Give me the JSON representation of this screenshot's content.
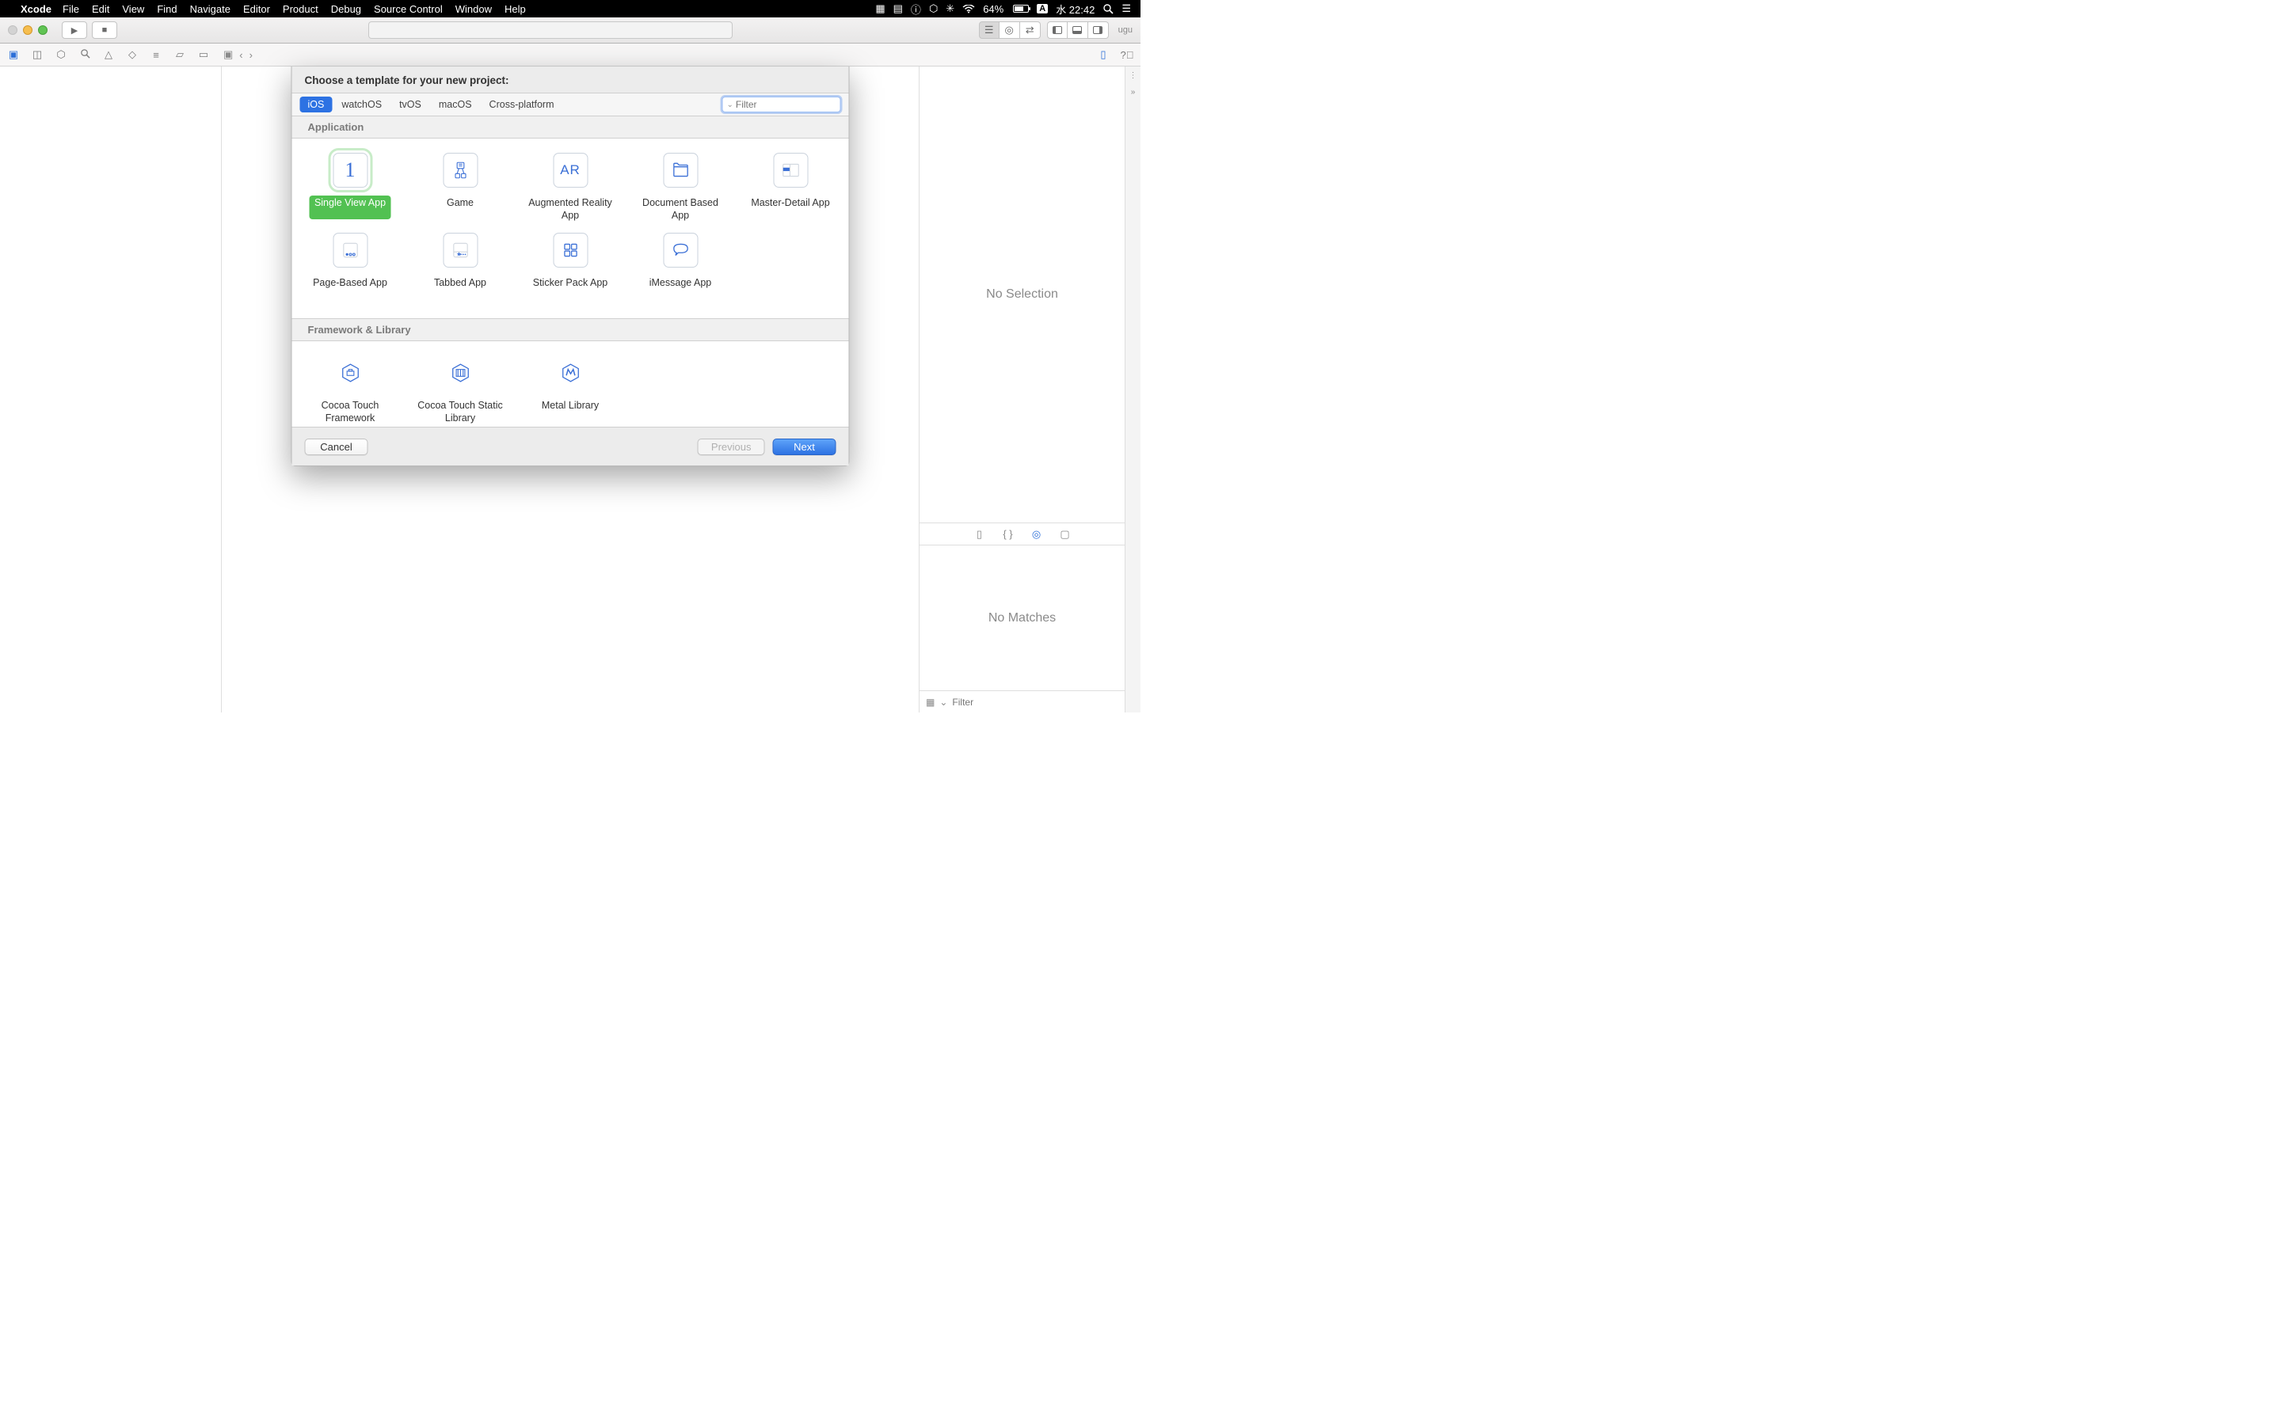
{
  "menubar": {
    "app": "Xcode",
    "items": [
      "File",
      "Edit",
      "View",
      "Find",
      "Navigate",
      "Editor",
      "Product",
      "Debug",
      "Source Control",
      "Window",
      "Help"
    ],
    "battery": "64%",
    "ime": "A",
    "clock": "水 22:42"
  },
  "toolbar": {
    "right_text": "ugu"
  },
  "sheet": {
    "title": "Choose a template for your new project:",
    "platforms": [
      "iOS",
      "watchOS",
      "tvOS",
      "macOS",
      "Cross-platform"
    ],
    "selected_platform": "iOS",
    "filter_placeholder": "Filter",
    "sections": {
      "application": "Application",
      "framework": "Framework & Library"
    },
    "apps": [
      {
        "label": "Single View App",
        "selected": true,
        "icon": "num1"
      },
      {
        "label": "Game",
        "icon": "game"
      },
      {
        "label": "Augmented Reality App",
        "icon": "ar"
      },
      {
        "label": "Document Based App",
        "icon": "doc"
      },
      {
        "label": "Master-Detail App",
        "icon": "master"
      },
      {
        "label": "Page-Based App",
        "icon": "page"
      },
      {
        "label": "Tabbed App",
        "icon": "tab"
      },
      {
        "label": "Sticker Pack App",
        "icon": "sticker"
      },
      {
        "label": "iMessage App",
        "icon": "msg"
      }
    ],
    "frameworks": [
      {
        "label": "Cocoa Touch Framework",
        "icon": "hex-tool"
      },
      {
        "label": "Cocoa Touch Static Library",
        "icon": "hex-lib"
      },
      {
        "label": "Metal Library",
        "icon": "hex-metal"
      }
    ],
    "buttons": {
      "cancel": "Cancel",
      "previous": "Previous",
      "next": "Next"
    }
  },
  "inspector": {
    "no_selection": "No Selection",
    "no_matches": "No Matches",
    "filter_placeholder": "Filter"
  }
}
